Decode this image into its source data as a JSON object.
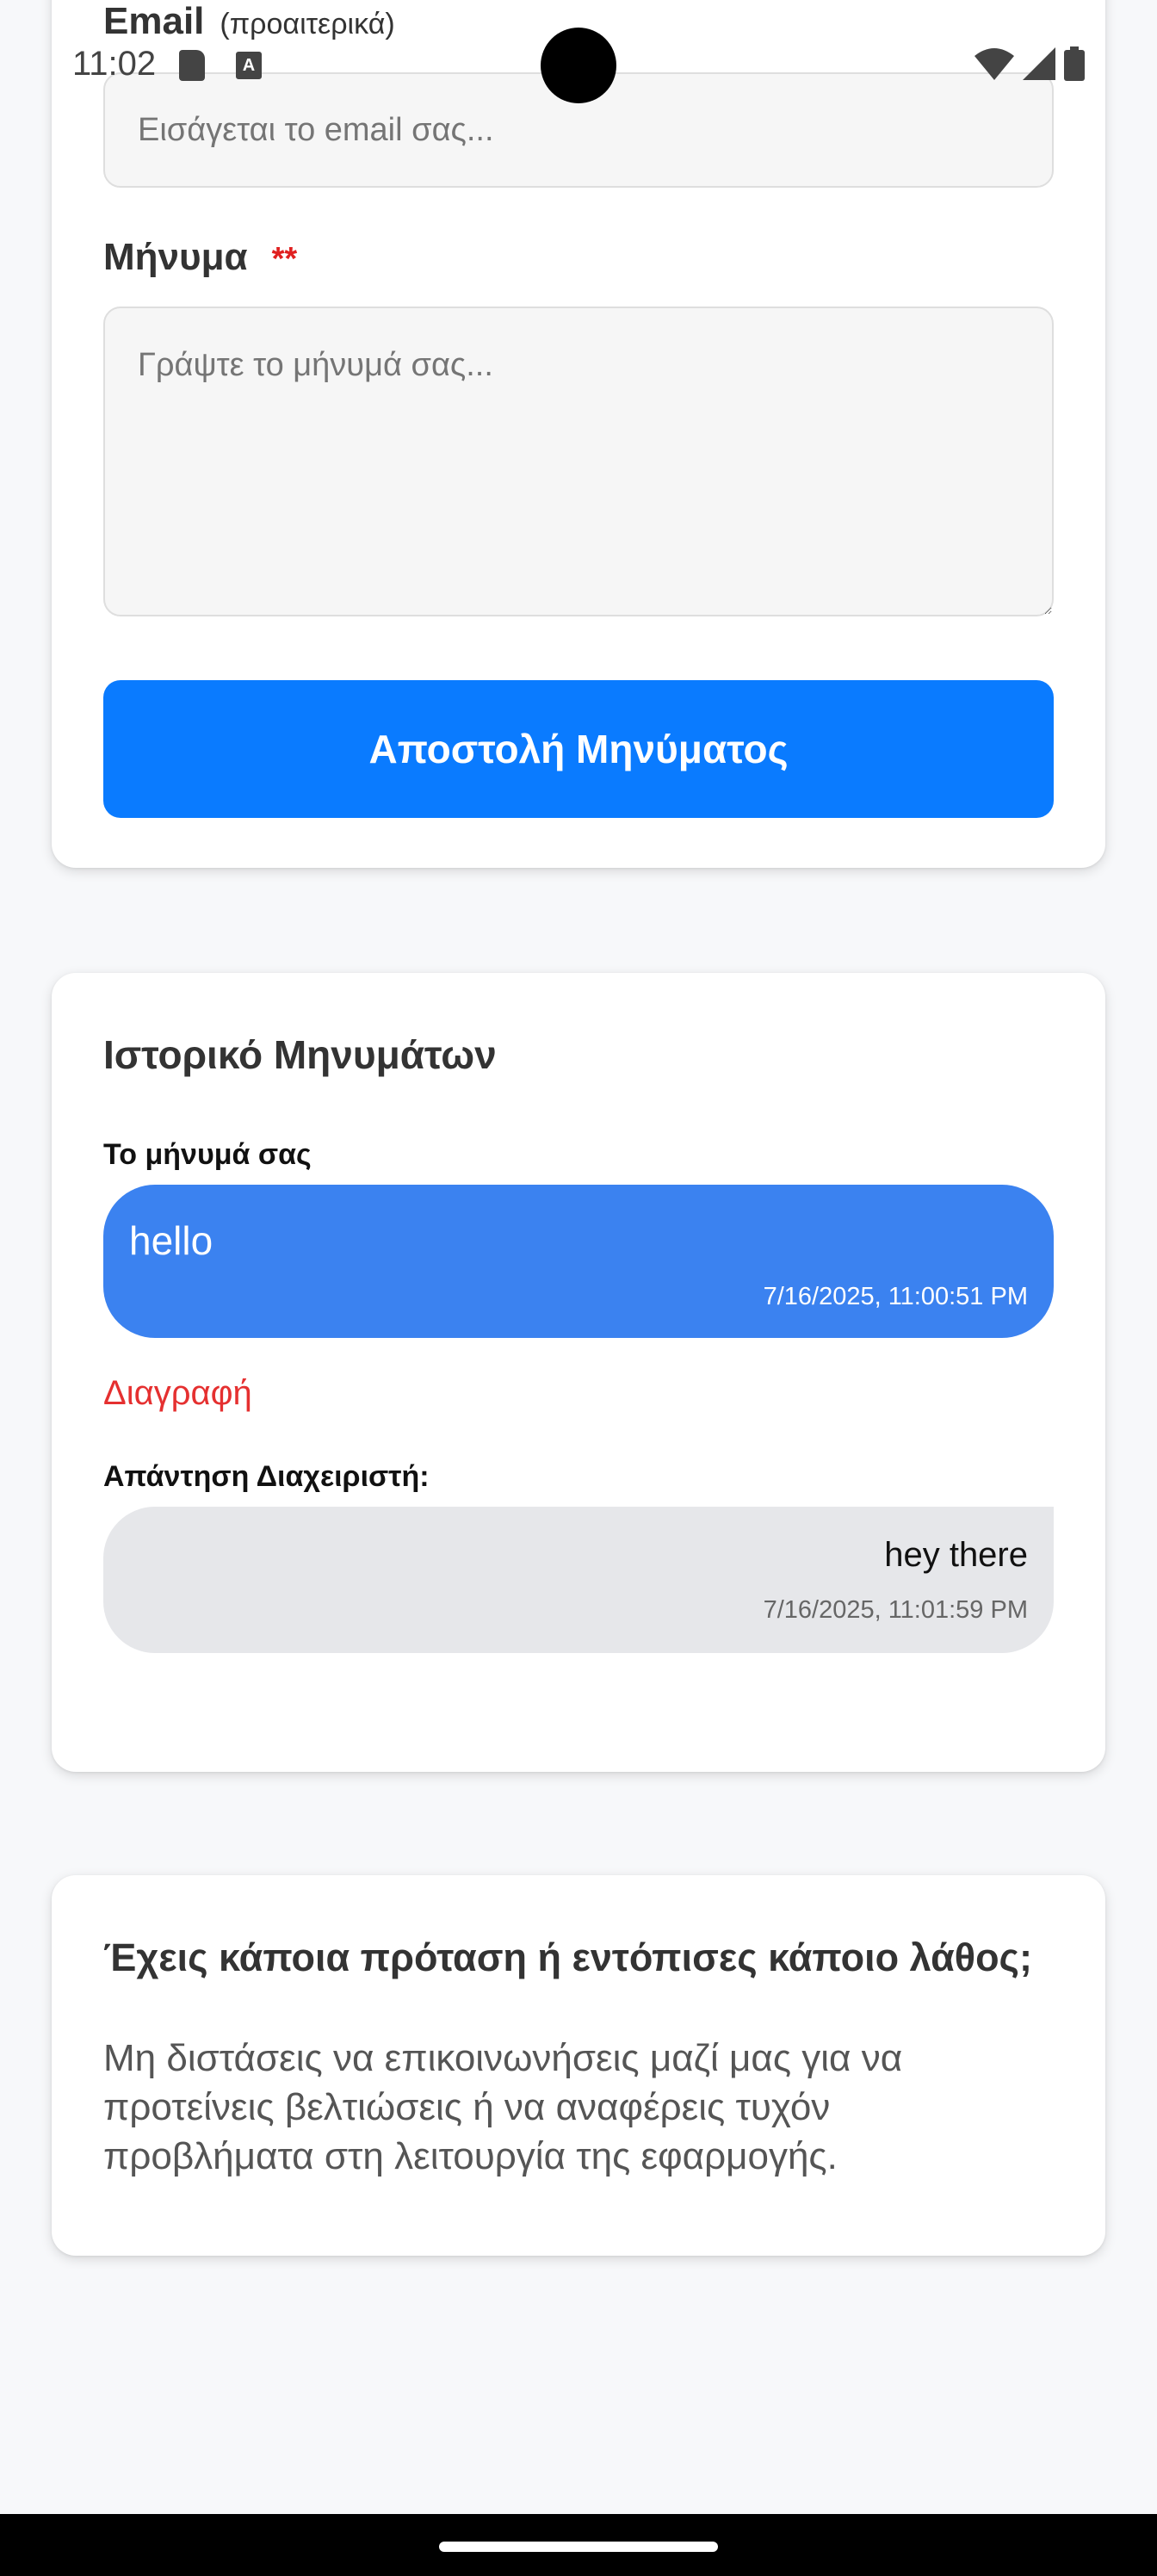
{
  "status_bar": {
    "time": "11:02"
  },
  "form": {
    "email_label": "Email",
    "email_hint": "(προαιτερικά)",
    "email_placeholder": "Εισάγεται το email σας...",
    "message_label": "Μήνυμα",
    "message_required_mark": "**",
    "message_placeholder": "Γράψτε το μήνυμά σας...",
    "send_label": "Αποστολή Μηνύματος",
    "accent_color": "#0a7bff"
  },
  "history": {
    "title": "Ιστορικό Μηνυμάτων",
    "user_label": "Το μήνυμά σας",
    "user_message": "hello",
    "user_timestamp": "7/16/2025, 11:00:51 PM",
    "delete_label": "Διαγραφή",
    "admin_label": "Απάντηση Διαχειριστή:",
    "admin_message": "hey there",
    "admin_timestamp": "7/16/2025, 11:01:59 PM",
    "user_bubble_color": "#3b82f0",
    "admin_bubble_color": "#e6e7ea",
    "delete_color": "#e53030"
  },
  "info": {
    "title": "Έχεις κάποια πρόταση ή εντόπισες κάποιο λάθος;",
    "text": "Μη διστάσεις να επικοινωνήσεις μαζί μας για να προτείνεις βελτιώσεις ή να αναφέρεις τυχόν προβλήματα στη λειτουργία της εφαρμογής."
  }
}
